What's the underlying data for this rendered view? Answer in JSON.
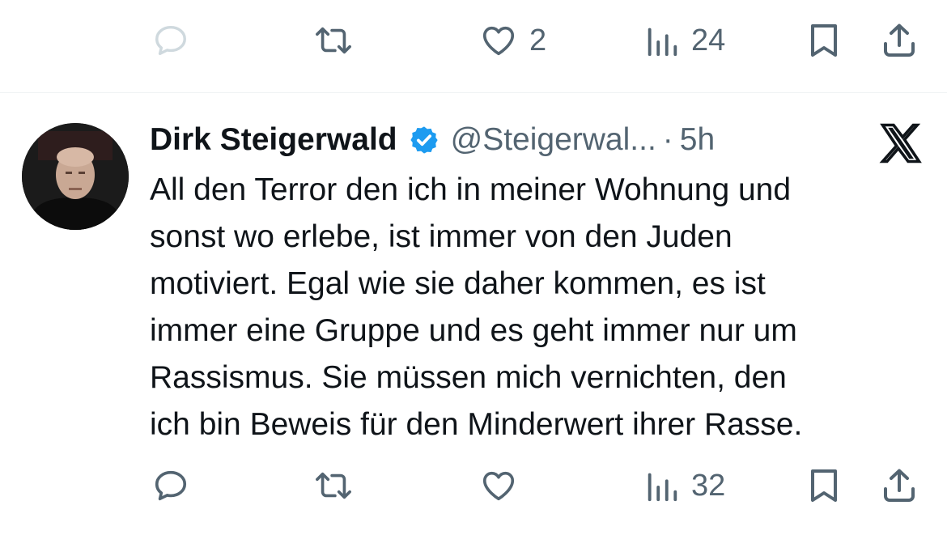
{
  "top_actions": {
    "like_count": "2",
    "views_count": "24"
  },
  "tweet": {
    "display_name": "Dirk Steigerwald",
    "handle": "@Steigerwal...",
    "separator": "·",
    "time": "5h",
    "lines": [
      "All den Terror den ich in meiner Wohnung und",
      "sonst wo erlebe, ist immer von den Juden",
      "motiviert. Egal wie sie daher kommen, es ist",
      "immer eine Gruppe und es geht immer nur um",
      "Rassismus. Sie müssen mich vernichten, den",
      "ich bin Beweis für den Minderwert ihrer Rasse."
    ],
    "views_count": "32"
  },
  "icons": {
    "reply": "reply-icon",
    "retweet": "retweet-icon",
    "like": "heart-icon",
    "views": "views-icon",
    "bookmark": "bookmark-icon",
    "share": "share-icon",
    "verified": "verified-badge-icon",
    "logo": "x-logo-icon"
  },
  "colors": {
    "text": "#0f1419",
    "secondary": "#536471",
    "verified": "#1d9bf0",
    "divider": "#eff3f4",
    "disabled": "#cfd9de"
  }
}
